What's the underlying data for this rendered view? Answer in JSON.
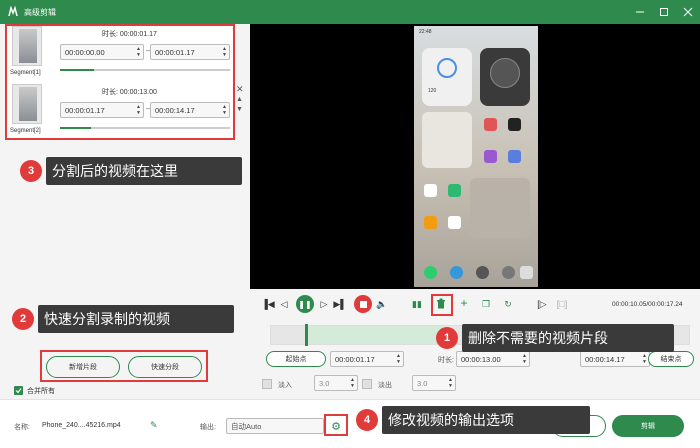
{
  "window": {
    "title": "高级剪辑"
  },
  "segments": [
    {
      "label": "Segment[1]",
      "duration_label": "时长:",
      "duration": "00:00:01.17",
      "start": "00:00:00.00",
      "end": "00:00:01.17",
      "progress": 0.2
    },
    {
      "label": "Segment[2]",
      "duration_label": "时长:",
      "duration": "00:00:13.00",
      "start": "00:00:01.17",
      "end": "00:00:14.17",
      "progress": 0.18
    }
  ],
  "callouts": {
    "c3": {
      "num": "3",
      "text": "分割后的视频在这里"
    },
    "c2": {
      "num": "2",
      "text": "快速分割录制的视频"
    },
    "c1": {
      "num": "1",
      "text": "删除不需要的视频片段"
    },
    "c4": {
      "num": "4",
      "text": "修改视频的输出选项"
    }
  },
  "left_buttons": {
    "new_segment": "新增片段",
    "quick_split": "快速分段",
    "merge_all": "合并所有"
  },
  "player": {
    "time_display": "00:00:10.05/00:00:17.24"
  },
  "trim": {
    "start_label": "起始点",
    "start_value": "00:00:01.17",
    "duration_label": "时长:",
    "duration_value": "00:00:13.00",
    "end_value": "00:00:14.17",
    "end_label": "结束点",
    "fade_in_label": "淡入",
    "fade_in_value": "3.0",
    "fade_out_label": "淡出",
    "fade_out_value": "3.0"
  },
  "bottom": {
    "name_label": "名称:",
    "name_value": "Phone_240....45216.mp4",
    "output_label": "输出:",
    "output_value": "自动Auto",
    "cancel_label": "返回",
    "confirm_label": "剪辑"
  },
  "phone": {
    "time": "22:48",
    "battery": "120"
  },
  "colors": {
    "accent": "#2f8a4e",
    "callout_red": "#e03a3a",
    "callout_bg": "#3a3a3a"
  }
}
